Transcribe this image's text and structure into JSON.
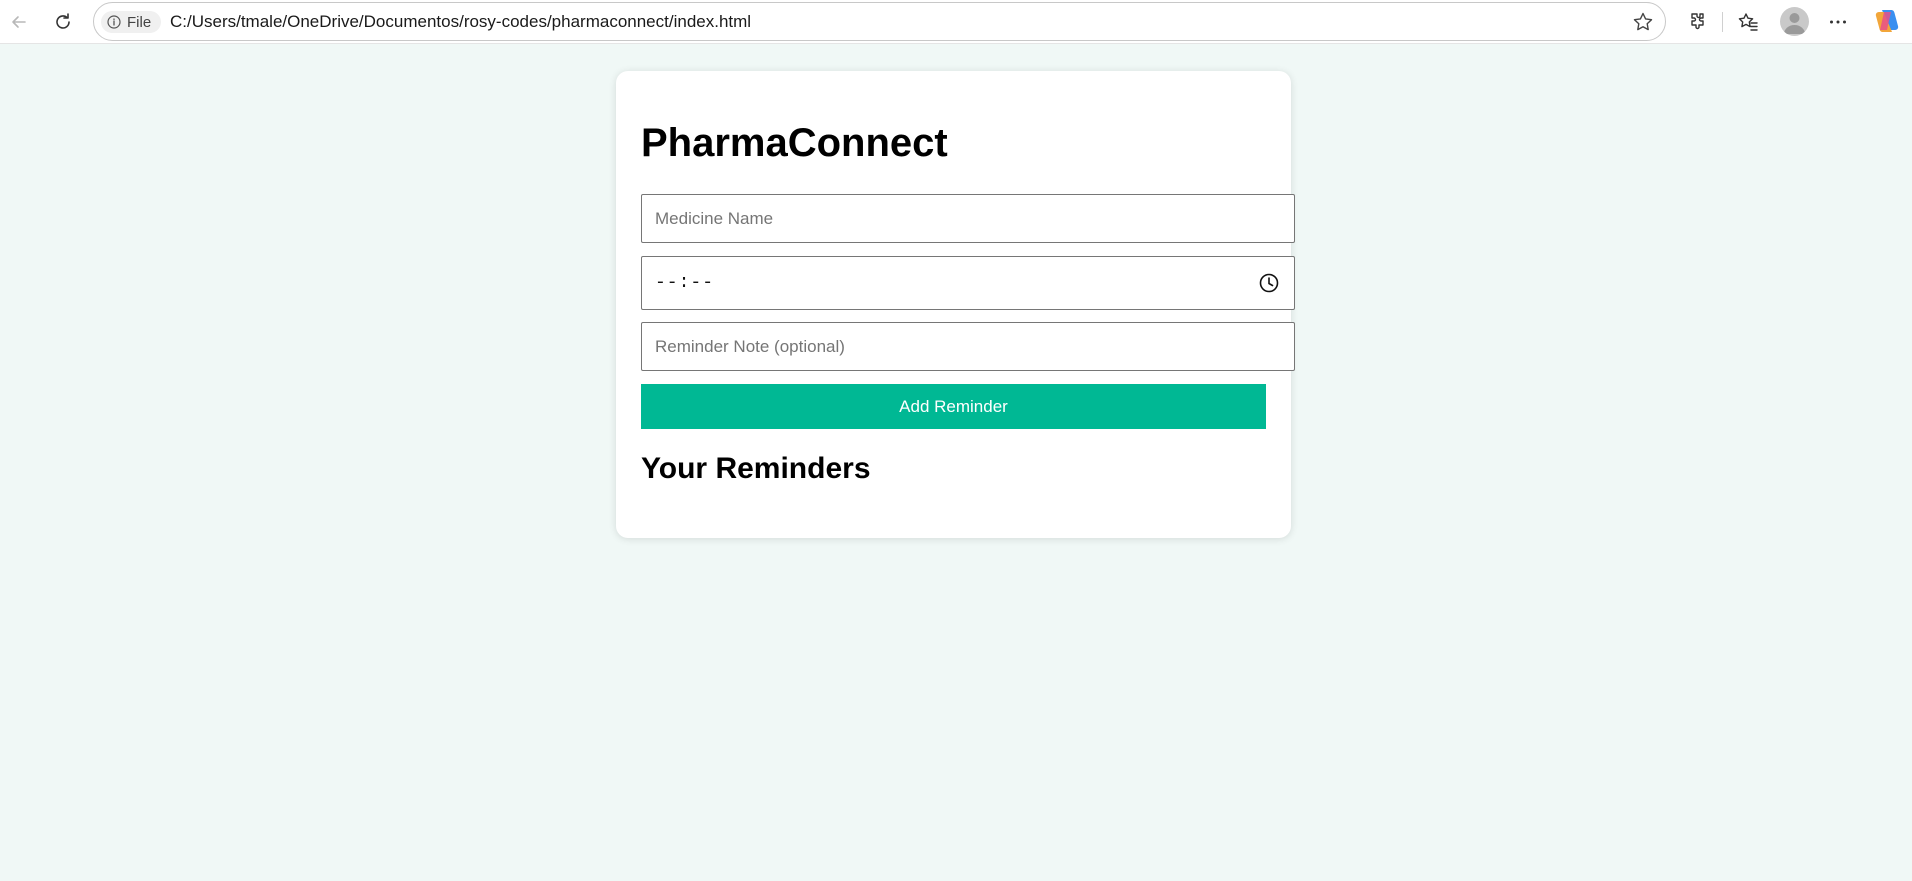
{
  "browser": {
    "file_chip_label": "File",
    "url": "C:/Users/tmale/OneDrive/Documentos/rosy-codes/pharmaconnect/index.html",
    "icons": [
      "back-icon",
      "refresh-icon",
      "info-icon",
      "favorite-star-icon",
      "extensions-icon",
      "favorites-icon",
      "profile-avatar",
      "more-icon",
      "copilot-icon"
    ]
  },
  "app": {
    "title": "PharmaConnect",
    "medicine_field": {
      "placeholder": "Medicine Name",
      "value": ""
    },
    "time_field": {
      "display": "--:--"
    },
    "note_field": {
      "placeholder": "Reminder Note (optional)",
      "value": ""
    },
    "add_button_label": "Add Reminder",
    "reminders_heading": "Your Reminders",
    "reminders": []
  },
  "colors": {
    "page_background": "#f0f8f6",
    "accent": "#00b894",
    "card": "#ffffff"
  }
}
